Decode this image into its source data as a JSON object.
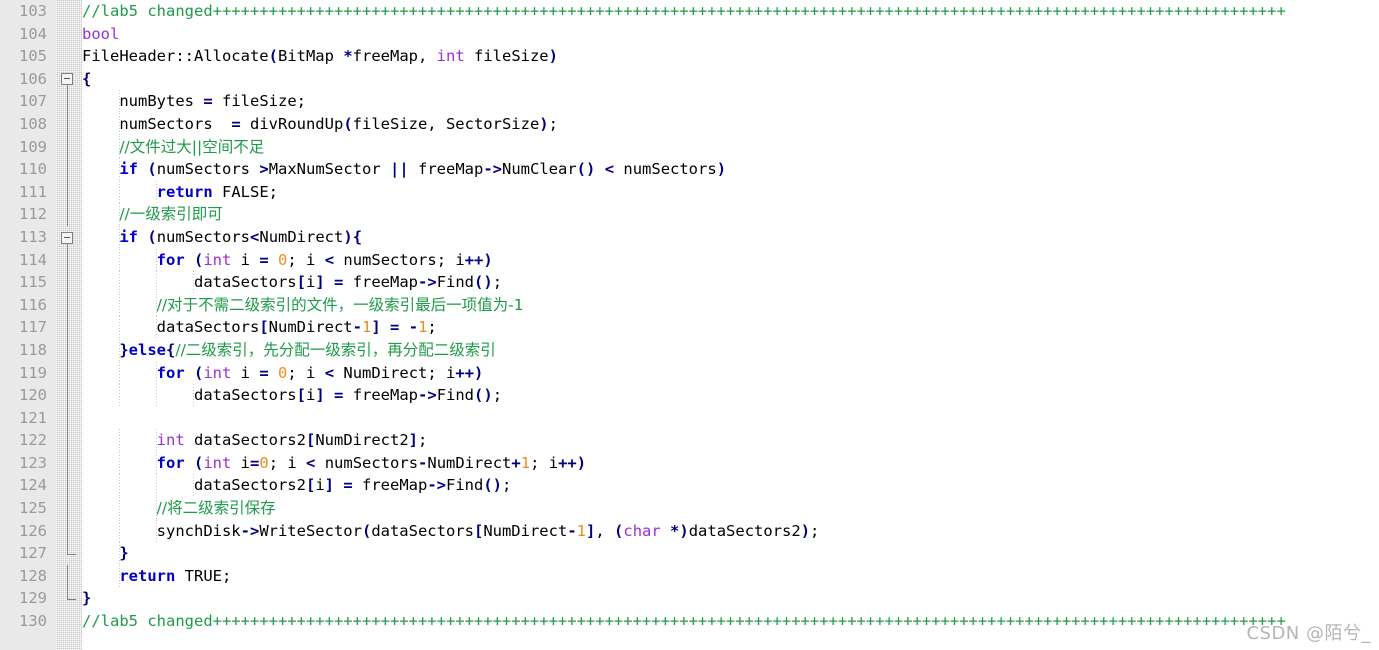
{
  "editor": {
    "title": "code-editor-source-view",
    "language": "C++",
    "first_line_number": 103,
    "last_line_number": 130,
    "gutter_background": "#e9e9e9",
    "line_number_color": "#9a9a9a",
    "background": "#ffffff",
    "colors": {
      "plain": "#000000",
      "comment": "#1f9b4a",
      "keyword": "#0000c8",
      "type": "#9b30d0",
      "number": "#ef8b1f",
      "punctuation": "#000080"
    }
  },
  "watermark": {
    "text": "CSDN @陌兮_"
  },
  "lines": [
    {
      "num": "103",
      "indent": 0,
      "fold": "none",
      "tokens": [
        {
          "c": "comment",
          "t": "//lab5 changed+++++++++++++++++++++++++++++++++++++++++++++++++++++++++++++++++++++++++++++++++++++++++++++++++++++++++++++++++++"
        }
      ]
    },
    {
      "num": "104",
      "indent": 0,
      "fold": "none",
      "tokens": [
        {
          "c": "type",
          "t": "bool"
        }
      ]
    },
    {
      "num": "105",
      "indent": 0,
      "fold": "none",
      "tokens": [
        {
          "c": "plain",
          "t": "FileHeader::Allocate"
        },
        {
          "c": "punct",
          "t": "("
        },
        {
          "c": "plain",
          "t": "BitMap "
        },
        {
          "c": "punct",
          "t": "*"
        },
        {
          "c": "plain",
          "t": "freeMap, "
        },
        {
          "c": "type",
          "t": "int"
        },
        {
          "c": "plain",
          "t": " fileSize"
        },
        {
          "c": "punct",
          "t": ")"
        }
      ]
    },
    {
      "num": "106",
      "indent": 0,
      "fold": "start",
      "tokens": [
        {
          "c": "punct",
          "t": "{"
        }
      ]
    },
    {
      "num": "107",
      "indent": 1,
      "fold": "line",
      "tokens": [
        {
          "c": "plain",
          "t": "    numBytes "
        },
        {
          "c": "op",
          "t": "="
        },
        {
          "c": "plain",
          "t": " fileSize;"
        }
      ]
    },
    {
      "num": "108",
      "indent": 1,
      "fold": "line",
      "tokens": [
        {
          "c": "plain",
          "t": "    numSectors  "
        },
        {
          "c": "op",
          "t": "="
        },
        {
          "c": "plain",
          "t": " divRoundUp"
        },
        {
          "c": "punct",
          "t": "("
        },
        {
          "c": "plain",
          "t": "fileSize, SectorSize"
        },
        {
          "c": "punct",
          "t": ")"
        },
        {
          "c": "plain",
          "t": ";"
        }
      ]
    },
    {
      "num": "109",
      "indent": 1,
      "fold": "line",
      "tokens": [
        {
          "c": "comment",
          "t": "    "
        },
        {
          "c": "cn",
          "t": "//文件过大||空间不足"
        }
      ]
    },
    {
      "num": "110",
      "indent": 1,
      "fold": "line",
      "tokens": [
        {
          "c": "plain",
          "t": "    "
        },
        {
          "c": "keyword",
          "t": "if"
        },
        {
          "c": "plain",
          "t": " "
        },
        {
          "c": "punct",
          "t": "("
        },
        {
          "c": "plain",
          "t": "numSectors "
        },
        {
          "c": "op",
          "t": ">"
        },
        {
          "c": "plain",
          "t": "MaxNumSector "
        },
        {
          "c": "op",
          "t": "||"
        },
        {
          "c": "plain",
          "t": " freeMap"
        },
        {
          "c": "op",
          "t": "->"
        },
        {
          "c": "plain",
          "t": "NumClear"
        },
        {
          "c": "punct",
          "t": "()"
        },
        {
          "c": "plain",
          "t": " "
        },
        {
          "c": "op",
          "t": "<"
        },
        {
          "c": "plain",
          "t": " numSectors"
        },
        {
          "c": "punct",
          "t": ")"
        }
      ]
    },
    {
      "num": "111",
      "indent": 2,
      "fold": "line",
      "tokens": [
        {
          "c": "plain",
          "t": "        "
        },
        {
          "c": "keyword",
          "t": "return"
        },
        {
          "c": "plain",
          "t": " FALSE;"
        }
      ]
    },
    {
      "num": "112",
      "indent": 1,
      "fold": "line",
      "tokens": [
        {
          "c": "comment",
          "t": "    "
        },
        {
          "c": "cn",
          "t": "//一级索引即可"
        }
      ]
    },
    {
      "num": "113",
      "indent": 1,
      "fold": "start",
      "tokens": [
        {
          "c": "plain",
          "t": "    "
        },
        {
          "c": "keyword",
          "t": "if"
        },
        {
          "c": "plain",
          "t": " "
        },
        {
          "c": "punct",
          "t": "("
        },
        {
          "c": "plain",
          "t": "numSectors"
        },
        {
          "c": "op",
          "t": "<"
        },
        {
          "c": "plain",
          "t": "NumDirect"
        },
        {
          "c": "punct",
          "t": ")"
        },
        {
          "c": "punct",
          "t": "{"
        }
      ]
    },
    {
      "num": "114",
      "indent": 2,
      "fold": "line",
      "tokens": [
        {
          "c": "plain",
          "t": "        "
        },
        {
          "c": "keyword",
          "t": "for"
        },
        {
          "c": "plain",
          "t": " "
        },
        {
          "c": "punct",
          "t": "("
        },
        {
          "c": "type",
          "t": "int"
        },
        {
          "c": "plain",
          "t": " i "
        },
        {
          "c": "op",
          "t": "="
        },
        {
          "c": "plain",
          "t": " "
        },
        {
          "c": "number",
          "t": "0"
        },
        {
          "c": "plain",
          "t": "; i "
        },
        {
          "c": "op",
          "t": "<"
        },
        {
          "c": "plain",
          "t": " numSectors; i"
        },
        {
          "c": "op",
          "t": "++"
        },
        {
          "c": "punct",
          "t": ")"
        }
      ]
    },
    {
      "num": "115",
      "indent": 3,
      "fold": "line",
      "tokens": [
        {
          "c": "plain",
          "t": "            dataSectors"
        },
        {
          "c": "punct",
          "t": "["
        },
        {
          "c": "plain",
          "t": "i"
        },
        {
          "c": "punct",
          "t": "]"
        },
        {
          "c": "plain",
          "t": " "
        },
        {
          "c": "op",
          "t": "="
        },
        {
          "c": "plain",
          "t": " freeMap"
        },
        {
          "c": "op",
          "t": "->"
        },
        {
          "c": "plain",
          "t": "Find"
        },
        {
          "c": "punct",
          "t": "()"
        },
        {
          "c": "plain",
          "t": ";"
        }
      ]
    },
    {
      "num": "116",
      "indent": 2,
      "fold": "line",
      "tokens": [
        {
          "c": "comment",
          "t": "        "
        },
        {
          "c": "cn",
          "t": "//对于不需二级索引的文件，一级索引最后一项值为-1"
        }
      ]
    },
    {
      "num": "117",
      "indent": 2,
      "fold": "line",
      "tokens": [
        {
          "c": "plain",
          "t": "        dataSectors"
        },
        {
          "c": "punct",
          "t": "["
        },
        {
          "c": "plain",
          "t": "NumDirect"
        },
        {
          "c": "op",
          "t": "-"
        },
        {
          "c": "number",
          "t": "1"
        },
        {
          "c": "punct",
          "t": "]"
        },
        {
          "c": "plain",
          "t": " "
        },
        {
          "c": "op",
          "t": "="
        },
        {
          "c": "plain",
          "t": " "
        },
        {
          "c": "op",
          "t": "-"
        },
        {
          "c": "number",
          "t": "1"
        },
        {
          "c": "plain",
          "t": ";"
        }
      ]
    },
    {
      "num": "118",
      "indent": 1,
      "fold": "line",
      "tokens": [
        {
          "c": "punct",
          "t": "    }"
        },
        {
          "c": "keyword",
          "t": "else"
        },
        {
          "c": "punct",
          "t": "{"
        },
        {
          "c": "cn",
          "t": "//二级索引，先分配一级索引，再分配二级索引"
        }
      ]
    },
    {
      "num": "119",
      "indent": 2,
      "fold": "line",
      "tokens": [
        {
          "c": "plain",
          "t": "        "
        },
        {
          "c": "keyword",
          "t": "for"
        },
        {
          "c": "plain",
          "t": " "
        },
        {
          "c": "punct",
          "t": "("
        },
        {
          "c": "type",
          "t": "int"
        },
        {
          "c": "plain",
          "t": " i "
        },
        {
          "c": "op",
          "t": "="
        },
        {
          "c": "plain",
          "t": " "
        },
        {
          "c": "number",
          "t": "0"
        },
        {
          "c": "plain",
          "t": "; i "
        },
        {
          "c": "op",
          "t": "<"
        },
        {
          "c": "plain",
          "t": " NumDirect; i"
        },
        {
          "c": "op",
          "t": "++"
        },
        {
          "c": "punct",
          "t": ")"
        }
      ]
    },
    {
      "num": "120",
      "indent": 3,
      "fold": "line",
      "tokens": [
        {
          "c": "plain",
          "t": "            dataSectors"
        },
        {
          "c": "punct",
          "t": "["
        },
        {
          "c": "plain",
          "t": "i"
        },
        {
          "c": "punct",
          "t": "]"
        },
        {
          "c": "plain",
          "t": " "
        },
        {
          "c": "op",
          "t": "="
        },
        {
          "c": "plain",
          "t": " freeMap"
        },
        {
          "c": "op",
          "t": "->"
        },
        {
          "c": "plain",
          "t": "Find"
        },
        {
          "c": "punct",
          "t": "()"
        },
        {
          "c": "plain",
          "t": ";"
        }
      ]
    },
    {
      "num": "121",
      "indent": 0,
      "fold": "line",
      "tokens": [
        {
          "c": "plain",
          "t": ""
        }
      ]
    },
    {
      "num": "122",
      "indent": 2,
      "fold": "line",
      "tokens": [
        {
          "c": "plain",
          "t": "        "
        },
        {
          "c": "type",
          "t": "int"
        },
        {
          "c": "plain",
          "t": " dataSectors2"
        },
        {
          "c": "punct",
          "t": "["
        },
        {
          "c": "plain",
          "t": "NumDirect2"
        },
        {
          "c": "punct",
          "t": "]"
        },
        {
          "c": "plain",
          "t": ";"
        }
      ]
    },
    {
      "num": "123",
      "indent": 2,
      "fold": "line",
      "tokens": [
        {
          "c": "plain",
          "t": "        "
        },
        {
          "c": "keyword",
          "t": "for"
        },
        {
          "c": "plain",
          "t": " "
        },
        {
          "c": "punct",
          "t": "("
        },
        {
          "c": "type",
          "t": "int"
        },
        {
          "c": "plain",
          "t": " i"
        },
        {
          "c": "op",
          "t": "="
        },
        {
          "c": "number",
          "t": "0"
        },
        {
          "c": "plain",
          "t": "; i "
        },
        {
          "c": "op",
          "t": "<"
        },
        {
          "c": "plain",
          "t": " numSectors"
        },
        {
          "c": "op",
          "t": "-"
        },
        {
          "c": "plain",
          "t": "NumDirect"
        },
        {
          "c": "op",
          "t": "+"
        },
        {
          "c": "number",
          "t": "1"
        },
        {
          "c": "plain",
          "t": "; i"
        },
        {
          "c": "op",
          "t": "++"
        },
        {
          "c": "punct",
          "t": ")"
        }
      ]
    },
    {
      "num": "124",
      "indent": 3,
      "fold": "line",
      "tokens": [
        {
          "c": "plain",
          "t": "            dataSectors2"
        },
        {
          "c": "punct",
          "t": "["
        },
        {
          "c": "plain",
          "t": "i"
        },
        {
          "c": "punct",
          "t": "]"
        },
        {
          "c": "plain",
          "t": " "
        },
        {
          "c": "op",
          "t": "="
        },
        {
          "c": "plain",
          "t": " freeMap"
        },
        {
          "c": "op",
          "t": "->"
        },
        {
          "c": "plain",
          "t": "Find"
        },
        {
          "c": "punct",
          "t": "()"
        },
        {
          "c": "plain",
          "t": ";"
        }
      ]
    },
    {
      "num": "125",
      "indent": 2,
      "fold": "line",
      "tokens": [
        {
          "c": "comment",
          "t": "        "
        },
        {
          "c": "cn",
          "t": "//将二级索引保存"
        }
      ]
    },
    {
      "num": "126",
      "indent": 2,
      "fold": "line",
      "tokens": [
        {
          "c": "plain",
          "t": "        synchDisk"
        },
        {
          "c": "op",
          "t": "->"
        },
        {
          "c": "plain",
          "t": "WriteSector"
        },
        {
          "c": "punct",
          "t": "("
        },
        {
          "c": "plain",
          "t": "dataSectors"
        },
        {
          "c": "punct",
          "t": "["
        },
        {
          "c": "plain",
          "t": "NumDirect"
        },
        {
          "c": "op",
          "t": "-"
        },
        {
          "c": "number",
          "t": "1"
        },
        {
          "c": "punct",
          "t": "]"
        },
        {
          "c": "plain",
          "t": ", "
        },
        {
          "c": "punct",
          "t": "("
        },
        {
          "c": "type",
          "t": "char"
        },
        {
          "c": "plain",
          "t": " "
        },
        {
          "c": "punct",
          "t": "*)"
        },
        {
          "c": "plain",
          "t": "dataSectors2"
        },
        {
          "c": "punct",
          "t": ")"
        },
        {
          "c": "plain",
          "t": ";"
        }
      ]
    },
    {
      "num": "127",
      "indent": 1,
      "fold": "end",
      "tokens": [
        {
          "c": "punct",
          "t": "    }"
        }
      ]
    },
    {
      "num": "128",
      "indent": 1,
      "fold": "line",
      "tokens": [
        {
          "c": "plain",
          "t": "    "
        },
        {
          "c": "keyword",
          "t": "return"
        },
        {
          "c": "plain",
          "t": " TRUE;"
        }
      ]
    },
    {
      "num": "129",
      "indent": 0,
      "fold": "end",
      "tokens": [
        {
          "c": "punct",
          "t": "}"
        }
      ]
    },
    {
      "num": "130",
      "indent": 0,
      "fold": "none",
      "tokens": [
        {
          "c": "comment",
          "t": "//lab5 changed+++++++++++++++++++++++++++++++++++++++++++++++++++++++++++++++++++++++++++++++++++++++++++++++++++++++++++++++++++"
        }
      ]
    }
  ]
}
